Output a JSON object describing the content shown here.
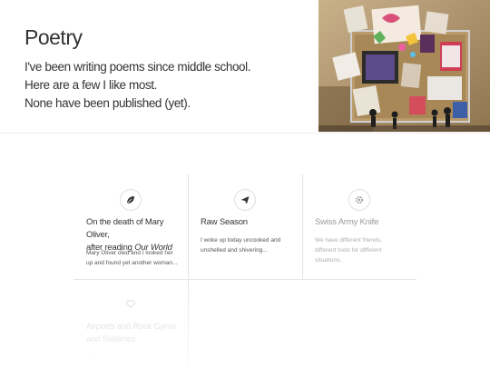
{
  "page": {
    "title": "Poetry",
    "intro_lines": [
      "I've been writing poems since middle school.",
      "Here are a few I like most.",
      "None have been published (yet)."
    ]
  },
  "photo": {
    "icon": "corkboard-collage-photo"
  },
  "poems": [
    {
      "icon": "leaf-icon",
      "title_prefix": "On the death of Mary Oliver,",
      "title_line2_prefix": "after reading ",
      "title_italic": "Our World",
      "excerpt_line1": "Mary Oliver died and I looked her",
      "excerpt_line2": "up and found yet another woman..."
    },
    {
      "icon": "paper-plane-icon",
      "title": "Raw Season",
      "excerpt_line1": "I woke up today uncooked and",
      "excerpt_line2": "unshelled and shivering..."
    },
    {
      "icon": "gear-icon",
      "title": "Swiss Army Knife",
      "excerpt_line1": "We have different friends,",
      "excerpt_line2": "different tools for different",
      "excerpt_line3": "situations."
    },
    {
      "icon": "gem-icon",
      "title_line1": "Airports and Rock Gyms",
      "title_line2": "and Sidelines",
      "excerpt_line1": "..."
    }
  ]
}
